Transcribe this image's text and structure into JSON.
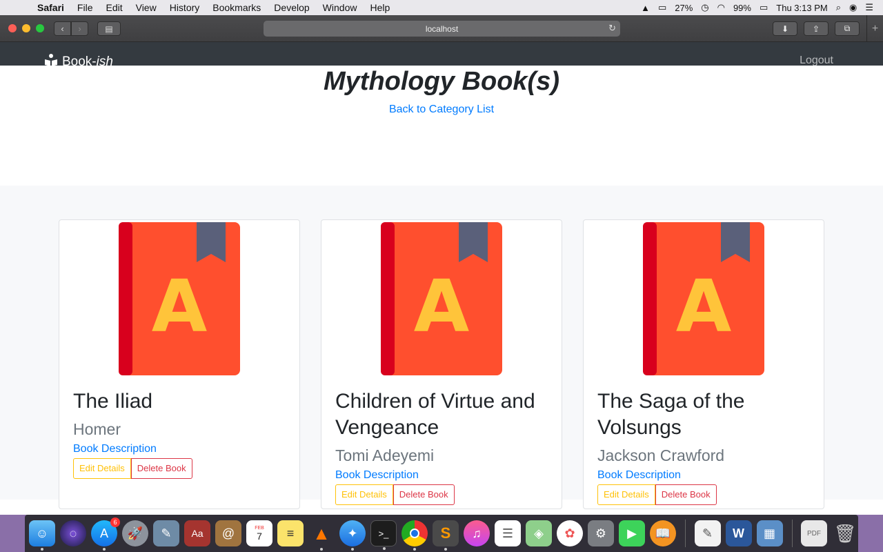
{
  "menubar": {
    "app": "Safari",
    "items": [
      "File",
      "Edit",
      "View",
      "History",
      "Bookmarks",
      "Develop",
      "Window",
      "Help"
    ],
    "battery_small": "27%",
    "battery": "99%",
    "clock": "Thu 3:13 PM"
  },
  "browser": {
    "url": "localhost"
  },
  "navbar": {
    "brand_main": "Book-",
    "brand_italic": "ish",
    "logout": "Logout"
  },
  "page": {
    "title": "Mythology Book(s)",
    "back_link": "Back to Category List"
  },
  "books": [
    {
      "title": "The Iliad",
      "author": "Homer",
      "description": "Book Description",
      "edit": "Edit Details",
      "delete": "Delete Book"
    },
    {
      "title": "Children of Virtue and Vengeance",
      "author": "Tomi Adeyemi",
      "description": "Book Description",
      "edit": "Edit Details",
      "delete": "Delete Book"
    },
    {
      "title": "The Saga of the Volsungs",
      "author": "Jackson Crawford",
      "description": "Book Description",
      "edit": "Edit Details",
      "delete": "Delete Book"
    }
  ],
  "cover": {
    "letter": "A",
    "colors": {
      "cover": "#ff4f2e",
      "spine": "#d8001d",
      "letter": "#ffc43a",
      "bookmark": "#5a607a"
    }
  },
  "dock": {
    "apps": [
      "finder-icon",
      "siri-icon",
      "app-store-icon",
      "launchpad-icon",
      "preview-icon",
      "dictionary-icon",
      "contacts-icon",
      "calendar-icon",
      "notes-icon",
      "vlc-icon",
      "safari-icon",
      "terminal-icon",
      "chrome-icon",
      "sublime-icon",
      "itunes-icon",
      "reminders-icon",
      "maps-icon",
      "photos-icon",
      "system-preferences-icon",
      "facetime-icon",
      "ibooks-icon",
      "textedit-icon",
      "word-icon",
      "preview-images-icon",
      "pdf-icon",
      "trash-icon"
    ],
    "app_store_badge": "6",
    "calendar_month": "FEB",
    "calendar_day": "7"
  }
}
